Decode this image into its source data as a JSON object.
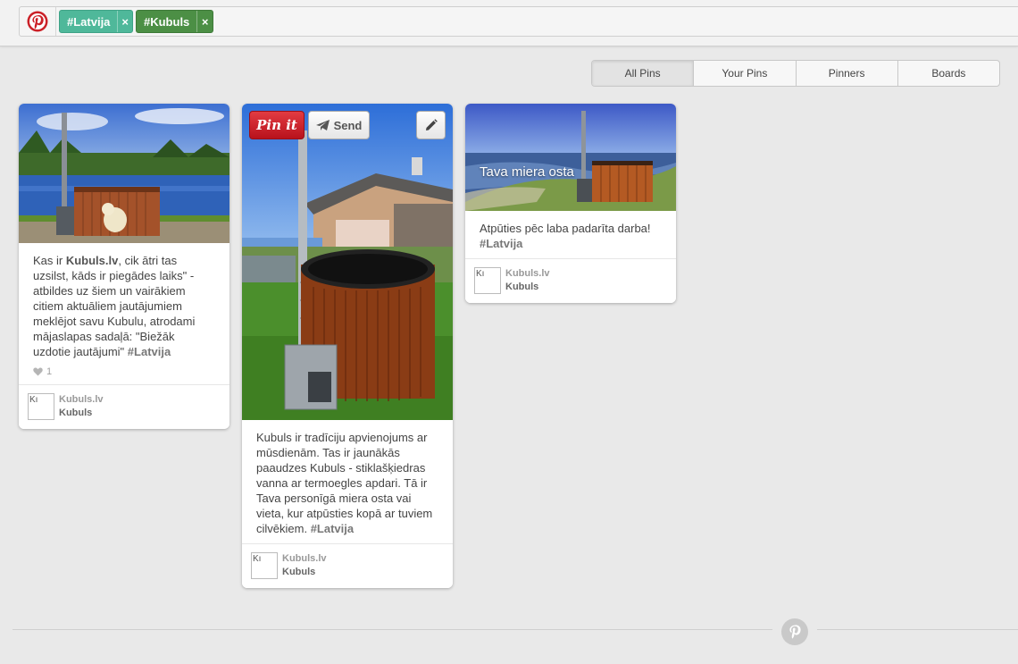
{
  "search": {
    "tags": [
      {
        "label": "#Latvija",
        "remove": "×",
        "color": "#4fb89a"
      },
      {
        "label": "#Kubuls",
        "remove": "×",
        "color": "#4c8f45"
      }
    ]
  },
  "tabs": [
    {
      "label": "All Pins",
      "active": true
    },
    {
      "label": "Your Pins",
      "active": false
    },
    {
      "label": "Pinners",
      "active": false
    },
    {
      "label": "Boards",
      "active": false
    }
  ],
  "pins": [
    {
      "desc_pre": "Kas ir ",
      "desc_link": "Kubuls.lv",
      "desc_post": ", cik ātri tas uzsilst, kāds ir piegādes laiks\" - atbildes uz šiem un vairākiem citiem aktuāliem jautājumiem meklējot savu Kubulu, atrodami mājaslapas sadaļā: \"Biežāk uzdotie jautājumi\" ",
      "hashtag": "#Latvija",
      "likes": "1",
      "avatar_alt": "Kı",
      "source": "Kubuls.lv",
      "board": "Kubuls"
    },
    {
      "pinit": "Pin it",
      "send": "Send",
      "desc_pre": "Kubuls ir tradīciju apvienojums ar mūsdienām. Tas ir jaunākās paaudzes Kubuls - stiklašķiedras vanna ar termoegles apdari. Tā ir Tava personīgā miera osta vai vieta, kur atpūsties kopā ar tuviem cilvēkiem. ",
      "hashtag": "#Latvija",
      "avatar_alt": "Kı",
      "source": "Kubuls.lv",
      "board": "Kubuls"
    },
    {
      "overlay": "Tava miera osta",
      "desc_pre": "Atpūties pēc laba padarīta darba! ",
      "hashtag": "#Latvija",
      "avatar_alt": "Kı",
      "source": "Kubuls.lv",
      "board": "Kubuls"
    }
  ],
  "colors": {
    "pinterest_red": "#cb2027",
    "background": "#e9e9e9"
  },
  "icons": [
    "pinterest-logo-icon",
    "heart-icon",
    "send-plane-icon",
    "pencil-icon",
    "pinterest-footer-icon"
  ]
}
